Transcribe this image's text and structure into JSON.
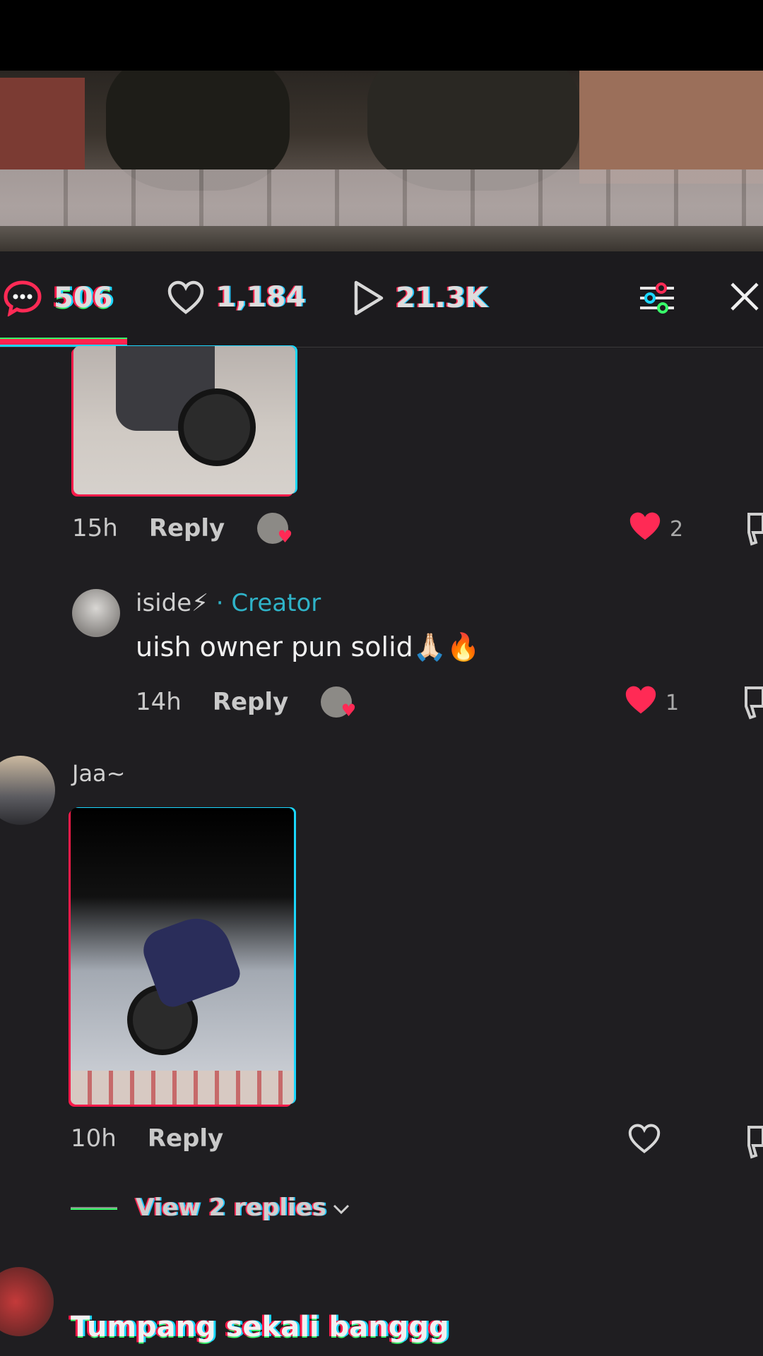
{
  "stats": {
    "comments": "506",
    "likes": "1,184",
    "plays": "21.3K"
  },
  "comments": [
    {
      "time": "15h",
      "reply_label": "Reply",
      "like_count": "2"
    },
    {
      "username": "iside⚡",
      "badge": "· Creator",
      "text": "uish owner pun solid🙏🏻🔥",
      "time": "14h",
      "reply_label": "Reply",
      "like_count": "1"
    },
    {
      "username": "Jaa~",
      "time": "10h",
      "reply_label": "Reply",
      "view_replies": "View 2 replies"
    },
    {
      "text": "Tumpang sekali banggg"
    }
  ],
  "colors": {
    "background": "#1f1e21",
    "accent_red": "#ff234f",
    "creator_teal": "#2fb3c8",
    "heart_red": "#ff2a55"
  },
  "icons": [
    "comment-bubble-icon",
    "heart-outline-icon",
    "play-icon",
    "filter-sliders-icon",
    "close-icon",
    "heart-filled-icon",
    "thumbs-down-icon",
    "chevron-down-icon"
  ]
}
